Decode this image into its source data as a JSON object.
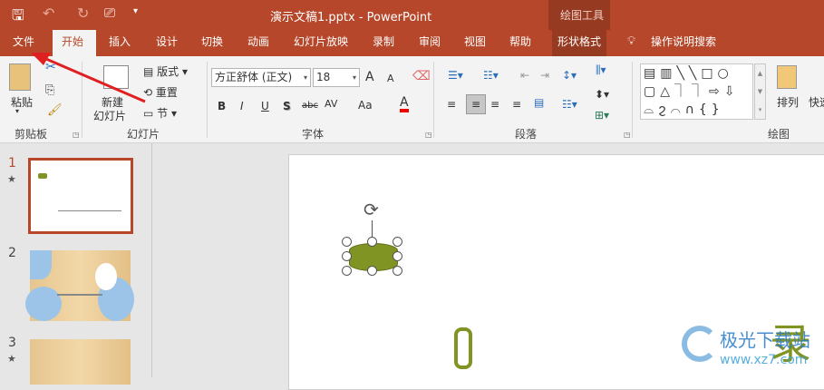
{
  "titlebar": {
    "title": "演示文稿1.pptx  -  PowerPoint",
    "context_group": "绘图工具",
    "icons": [
      "save-icon",
      "undo-icon",
      "redo-icon",
      "present-from-start-icon",
      "customize-qat-icon"
    ]
  },
  "tabs": [
    {
      "label": "文件"
    },
    {
      "label": "开始",
      "active": true
    },
    {
      "label": "插入"
    },
    {
      "label": "设计"
    },
    {
      "label": "切换"
    },
    {
      "label": "动画"
    },
    {
      "label": "幻灯片放映"
    },
    {
      "label": "录制"
    },
    {
      "label": "审阅"
    },
    {
      "label": "视图"
    },
    {
      "label": "帮助"
    },
    {
      "label": "形状格式"
    }
  ],
  "tell_me": "操作说明搜索",
  "ribbon": {
    "clipboard": {
      "label": "剪贴板",
      "paste": "粘贴"
    },
    "slides": {
      "label": "幻灯片",
      "new_slide_1": "新建",
      "new_slide_2": "幻灯片",
      "layout": "版式",
      "reset": "重置",
      "section": "节"
    },
    "font": {
      "label": "字体",
      "font_name": "方正舒体 (正文)",
      "font_size": "18",
      "bold": "B",
      "italic": "I",
      "underline": "U",
      "shadow": "S",
      "strike": "abc",
      "spacing": "AV",
      "case": "Aa",
      "color_letter": "A",
      "grow": "A",
      "shrink": "A"
    },
    "paragraph": {
      "label": "段落"
    },
    "drawing": {
      "label": "绘图",
      "arrange": "排列",
      "quick_styles": "快速"
    }
  },
  "slides": [
    {
      "number": "1",
      "has_animation": true,
      "selected": true
    },
    {
      "number": "2"
    },
    {
      "number": "3",
      "has_animation": true
    }
  ],
  "colors": {
    "accent": "#b7472a",
    "shape": "#7f9423"
  },
  "watermark": {
    "name": "极光下载站",
    "url": "www.xz7.com"
  }
}
